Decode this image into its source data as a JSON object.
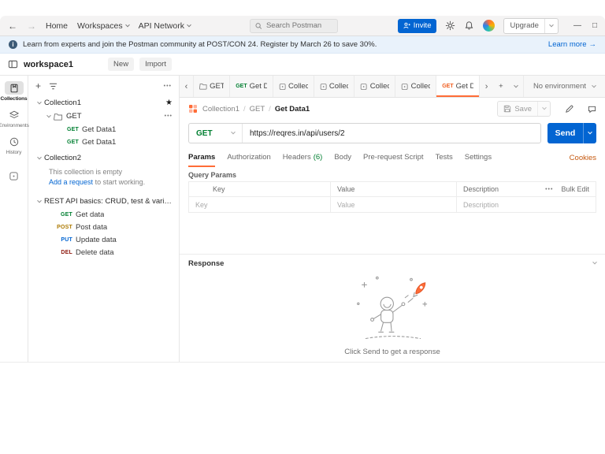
{
  "glyphs": {
    "back": "←",
    "forward": "→",
    "minimize": "—",
    "maximize": "□",
    "star": "★",
    "more": "•••",
    "scroll_left": "‹",
    "scroll_right": "›",
    "plus": "+"
  },
  "colors": {
    "accent": "#ff6c37",
    "primary_blue": "#0265d2",
    "method_get": "#007f31",
    "method_post": "#ad7a03",
    "method_put": "#0265d2",
    "method_delete": "#8e1a10"
  },
  "titlebar": {
    "home": "Home",
    "workspaces": "Workspaces",
    "api_network": "API Network",
    "search_placeholder": "Search Postman",
    "invite": "Invite",
    "upgrade": "Upgrade"
  },
  "banner": {
    "message": "Learn from experts and join the Postman community at POST/CON 24. Register by March 26 to save 30%.",
    "learn_more": "Learn more",
    "arrow": "→"
  },
  "workspace_bar": {
    "name": "workspace1",
    "new_button": "New",
    "import_button": "Import"
  },
  "rail": {
    "items": [
      "Collections",
      "Environments",
      "History"
    ]
  },
  "tree": {
    "collection1": "Collection1",
    "folder": "GET",
    "folder_requests": [
      {
        "method": "GET",
        "name": "Get Data1"
      },
      {
        "method": "GET",
        "name": "Get Data1"
      }
    ],
    "collection2": "Collection2",
    "empty_message": "This collection is empty",
    "empty_link": "Add a request",
    "empty_suffix": "to start working.",
    "collection3": "REST API basics: CRUD, test & variable",
    "collection3_requests": [
      {
        "method": "GET",
        "name": "Get data"
      },
      {
        "method": "POST",
        "name": "Post data"
      },
      {
        "method": "PUT",
        "name": "Update data"
      },
      {
        "method": "DEL",
        "name": "Delete data"
      }
    ]
  },
  "tabstrip": {
    "tabs": [
      {
        "kind": "folder",
        "label": "GET"
      },
      {
        "kind": "request",
        "method": "GET",
        "label": "Get D"
      },
      {
        "kind": "collection",
        "label": "Collec"
      },
      {
        "kind": "collection",
        "label": "Collec"
      },
      {
        "kind": "collection",
        "label": "Collec"
      },
      {
        "kind": "collection",
        "label": "Collec"
      },
      {
        "kind": "request",
        "method": "GET",
        "label": "Get D",
        "active": true
      }
    ],
    "environment": "No environment"
  },
  "request": {
    "breadcrumb": {
      "collection": "Collection1",
      "folder": "GET",
      "name": "Get Data1",
      "separator": "/"
    },
    "save": "Save",
    "method": "GET",
    "url": "https://reqres.in/api/users/2",
    "send": "Send",
    "tabs": [
      {
        "label": "Params",
        "active": true
      },
      {
        "label": "Authorization"
      },
      {
        "label": "Headers",
        "badge": "(6)"
      },
      {
        "label": "Body"
      },
      {
        "label": "Pre-request Script"
      },
      {
        "label": "Tests"
      },
      {
        "label": "Settings"
      }
    ],
    "cookies": "Cookies",
    "section": "Query Params",
    "params_table": {
      "headers": [
        "Key",
        "Value",
        "Description"
      ],
      "bulk_edit": "Bulk Edit",
      "row_placeholders": [
        "Key",
        "Value",
        "Description"
      ]
    }
  },
  "response": {
    "title": "Response",
    "empty_hint": "Click Send to get a response"
  }
}
